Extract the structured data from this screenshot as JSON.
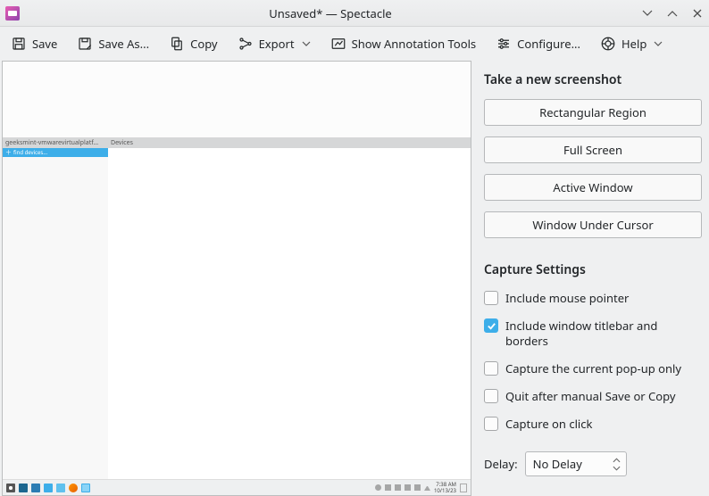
{
  "window": {
    "title": "Unsaved* — Spectacle"
  },
  "toolbar": {
    "save": "Save",
    "save_as": "Save As...",
    "copy": "Copy",
    "export": "Export",
    "annotate": "Show Annotation Tools",
    "configure": "Configure...",
    "help": "Help"
  },
  "preview_content": {
    "col1_header": "geeksmint-vmwarevirtualplatf...",
    "col2_header": "Devices",
    "side_row": "find devices...",
    "clock_time": "7:38 AM",
    "clock_date": "10/13/23"
  },
  "sidebar": {
    "title": "Take a new screenshot",
    "buttons": {
      "rect": "Rectangular Region",
      "full": "Full Screen",
      "active": "Active Window",
      "cursor": "Window Under Cursor"
    },
    "settings_title": "Capture Settings",
    "checks": {
      "mouse": "Include mouse pointer",
      "titlebar": "Include window titlebar and borders",
      "popup": "Capture the current pop-up only",
      "quit": "Quit after manual Save or Copy",
      "click": "Capture on click"
    },
    "delay_label": "Delay:",
    "delay_value": "No Delay"
  }
}
